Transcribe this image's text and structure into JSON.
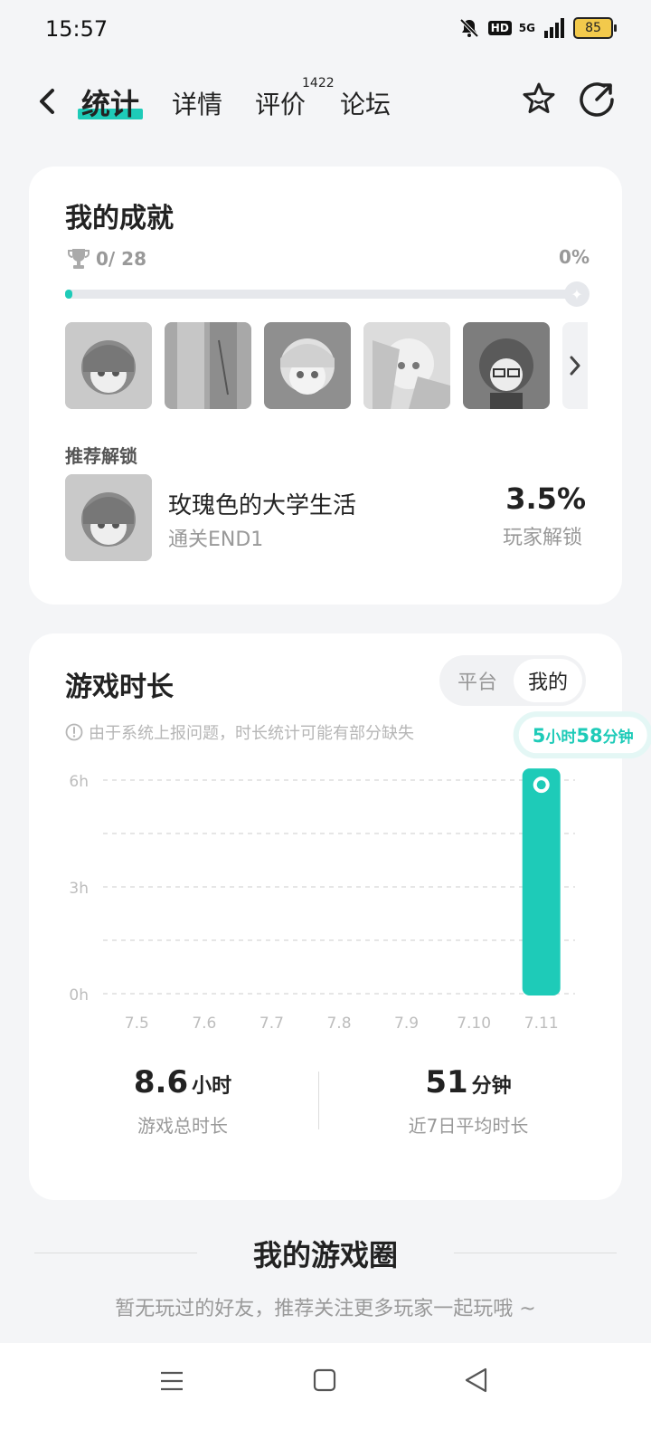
{
  "status_bar": {
    "time": "15:57",
    "hd": "HD",
    "network": "5G",
    "battery": "85"
  },
  "nav": {
    "tabs": [
      {
        "label": "统计",
        "active": true
      },
      {
        "label": "详情"
      },
      {
        "label": "评价",
        "badge": "1422"
      },
      {
        "label": "论坛"
      }
    ],
    "accent_color": "#1ecbb8"
  },
  "achievements": {
    "title": "我的成就",
    "unlocked": "0/ 28",
    "percent": "0%",
    "progress_fraction": 0,
    "recommend_label": "推荐解锁",
    "recommended": {
      "name": "玫瑰色的大学生活",
      "condition": "通关END1",
      "rate": "3.5%",
      "rate_label": "玩家解锁"
    }
  },
  "playtime": {
    "title": "游戏时长",
    "segment": {
      "platform": "平台",
      "mine": "我的",
      "selected": "mine"
    },
    "notice": "由于系统上报问题，时长统计可能有部分缺失",
    "tooltip": {
      "value1": "5",
      "unit1": "小时",
      "value2": "58",
      "unit2": "分钟"
    },
    "total": {
      "value": "8.6",
      "unit": "小时",
      "label": "游戏总时长"
    },
    "average": {
      "value": "51",
      "unit": "分钟",
      "label": "近7日平均时长"
    }
  },
  "chart_data": {
    "type": "bar",
    "categories": [
      "7.5",
      "7.6",
      "7.7",
      "7.8",
      "7.9",
      "7.10",
      "7.11"
    ],
    "values": [
      0,
      0,
      0,
      0,
      0,
      0,
      5.97
    ],
    "y_ticks": [
      "0h",
      "3h",
      "6h"
    ],
    "ylim": [
      0,
      6
    ],
    "grid": true,
    "color": "#1ecbb8"
  },
  "game_circle": {
    "title": "我的游戏圈",
    "empty_text": "暂无玩过的好友，推荐关注更多玩家一起玩哦 ~"
  }
}
